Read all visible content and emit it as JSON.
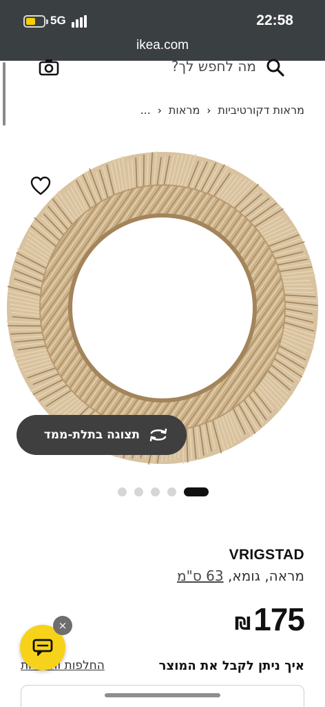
{
  "status_bar": {
    "network": "5G",
    "time": "22:58",
    "battery_level": 0.55,
    "url": "ikea.com"
  },
  "search": {
    "placeholder": "מה לחפש לך?"
  },
  "breadcrumb": {
    "items": [
      "...",
      "מראות",
      "מראות דקורטיביות"
    ]
  },
  "product_image": {
    "view_3d_label": "תצוגה בתלת-ממד",
    "dots_total": 5,
    "active_dot": 5
  },
  "product": {
    "name": "VRIGSTAD",
    "description": "מראה, גומא,",
    "size": "63 ס\"מ",
    "price_amount": "175",
    "currency": "₪"
  },
  "delivery": {
    "title": "איך ניתן לקבל את המוצר",
    "returns_link": "החלפות והחזרות"
  },
  "chat": {
    "close_symbol": "×"
  },
  "colors": {
    "status_bar": "#3a3f42",
    "chat_button": "#f7d21b",
    "battery": "#f5d000",
    "button_dark": "#3f3f3f"
  },
  "icons": [
    "search-icon",
    "camera-icon",
    "heart-icon",
    "rotate-3d-icon",
    "chat-icon",
    "close-icon",
    "chevron-left-icon"
  ]
}
